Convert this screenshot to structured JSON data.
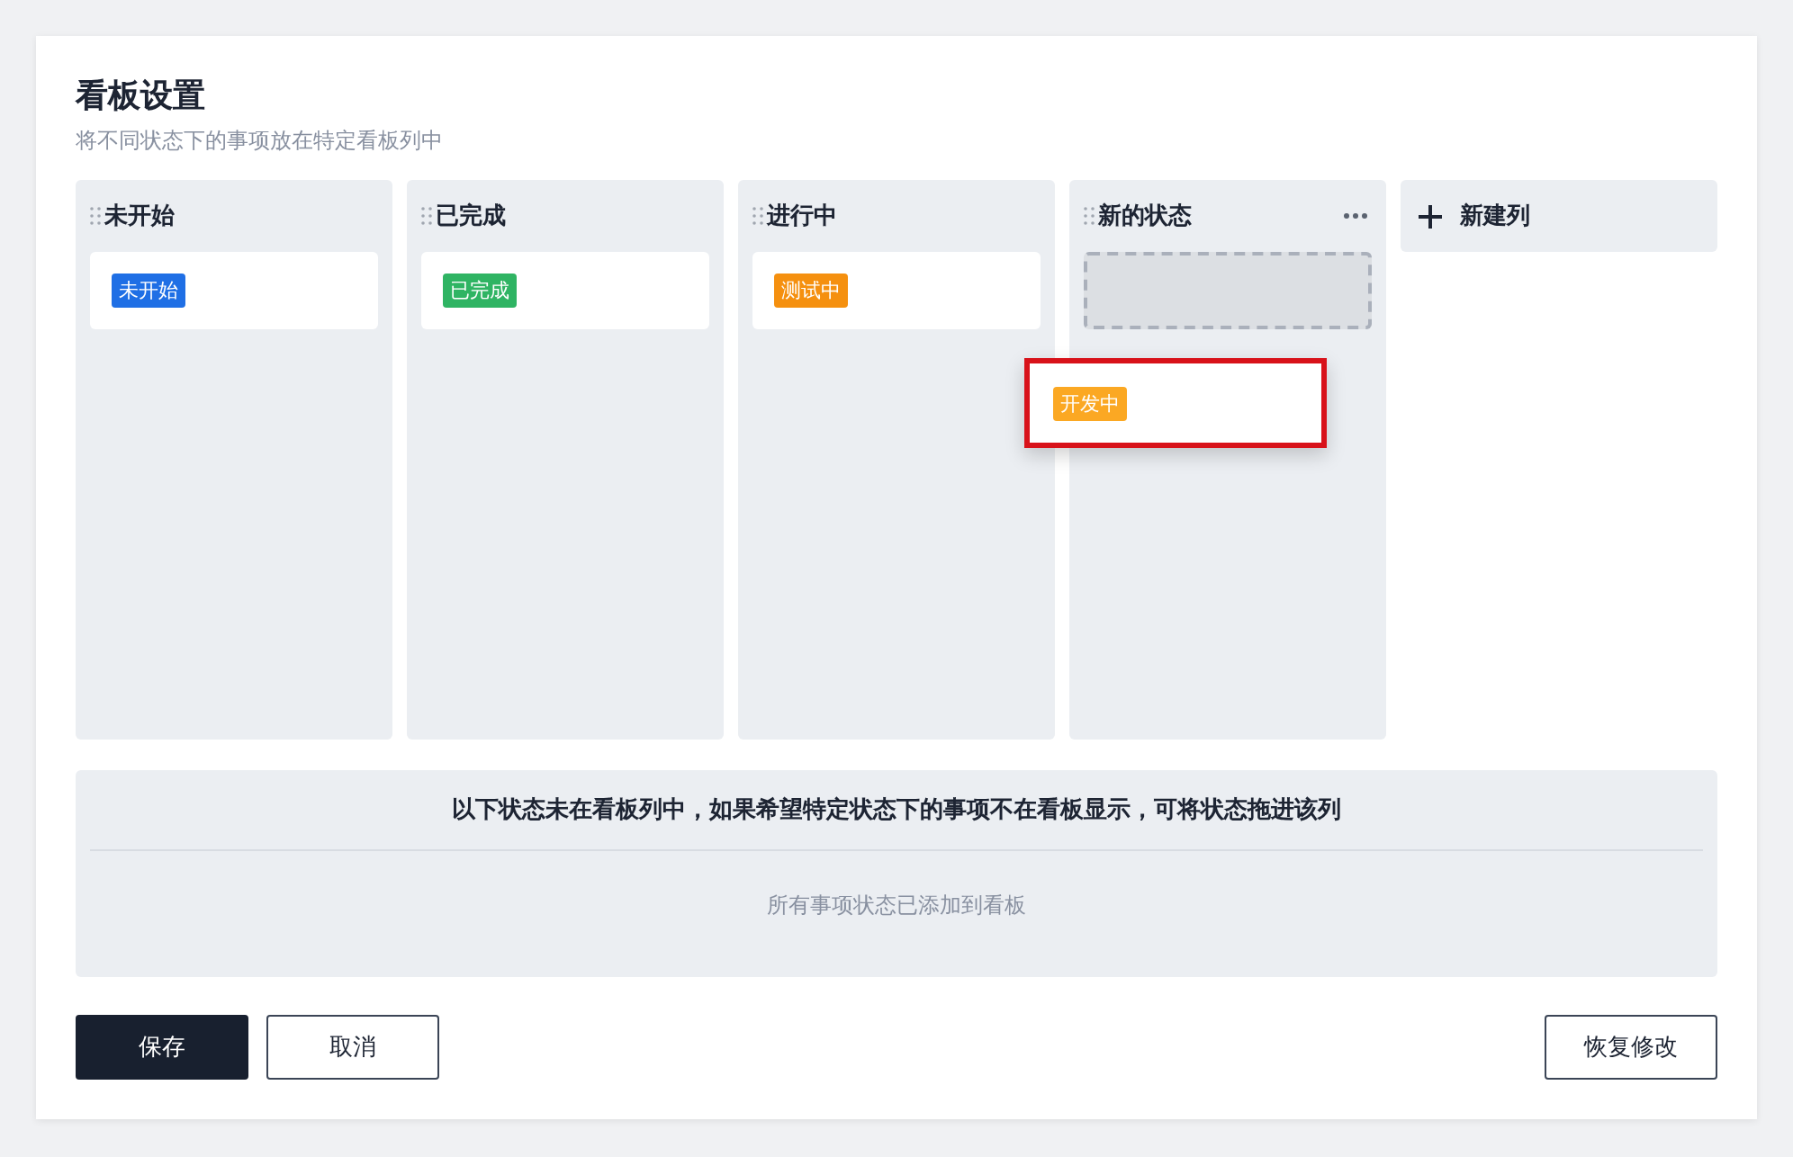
{
  "dialog": {
    "title": "看板设置",
    "subtitle": "将不同状态下的事项放在特定看板列中"
  },
  "columns": [
    {
      "kind": "status",
      "title": "未开始",
      "menu": false,
      "cards": [
        {
          "kind": "card",
          "label": "未开始",
          "color": "#1f6fe5"
        }
      ]
    },
    {
      "kind": "status",
      "title": "已完成",
      "menu": false,
      "cards": [
        {
          "kind": "card",
          "label": "已完成",
          "color": "#2fb463"
        }
      ]
    },
    {
      "kind": "status",
      "title": "进行中",
      "menu": false,
      "cards": [
        {
          "kind": "card",
          "label": "测试中",
          "color": "#f5900f"
        }
      ]
    },
    {
      "kind": "status",
      "title": "新的状态",
      "menu": true,
      "cards": [
        {
          "kind": "drop-slot"
        }
      ]
    },
    {
      "kind": "add",
      "title": "新建列"
    }
  ],
  "dragging_card": {
    "label": "开发中",
    "color": "#fba823"
  },
  "unassigned": {
    "heading": "以下状态未在看板列中，如果希望特定状态下的事项不在看板显示，可将状态拖进该列",
    "empty_text": "所有事项状态已添加到看板"
  },
  "buttons": [
    {
      "kind": "primary",
      "label": "保存"
    },
    {
      "kind": "secondary",
      "label": "取消"
    },
    {
      "kind": "reset",
      "label": "恢复修改"
    }
  ]
}
